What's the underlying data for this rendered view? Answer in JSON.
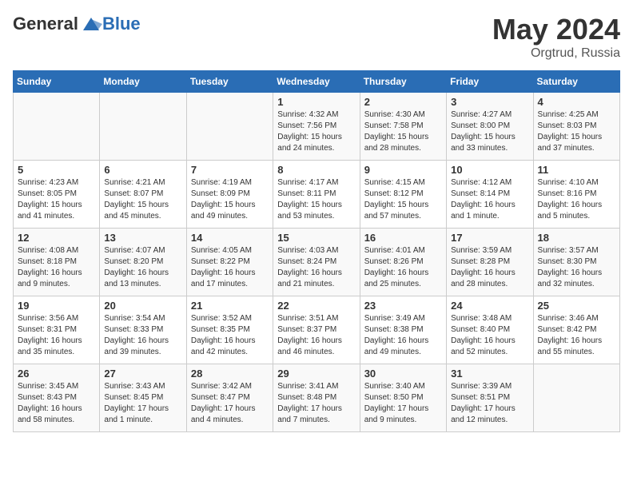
{
  "header": {
    "logo_general": "General",
    "logo_blue": "Blue",
    "title": "May 2024",
    "subtitle": "Orgtrud, Russia"
  },
  "days_of_week": [
    "Sunday",
    "Monday",
    "Tuesday",
    "Wednesday",
    "Thursday",
    "Friday",
    "Saturday"
  ],
  "weeks": [
    [
      {
        "day": "",
        "info": ""
      },
      {
        "day": "",
        "info": ""
      },
      {
        "day": "",
        "info": ""
      },
      {
        "day": "1",
        "info": "Sunrise: 4:32 AM\nSunset: 7:56 PM\nDaylight: 15 hours and 24 minutes."
      },
      {
        "day": "2",
        "info": "Sunrise: 4:30 AM\nSunset: 7:58 PM\nDaylight: 15 hours and 28 minutes."
      },
      {
        "day": "3",
        "info": "Sunrise: 4:27 AM\nSunset: 8:00 PM\nDaylight: 15 hours and 33 minutes."
      },
      {
        "day": "4",
        "info": "Sunrise: 4:25 AM\nSunset: 8:03 PM\nDaylight: 15 hours and 37 minutes."
      }
    ],
    [
      {
        "day": "5",
        "info": "Sunrise: 4:23 AM\nSunset: 8:05 PM\nDaylight: 15 hours and 41 minutes."
      },
      {
        "day": "6",
        "info": "Sunrise: 4:21 AM\nSunset: 8:07 PM\nDaylight: 15 hours and 45 minutes."
      },
      {
        "day": "7",
        "info": "Sunrise: 4:19 AM\nSunset: 8:09 PM\nDaylight: 15 hours and 49 minutes."
      },
      {
        "day": "8",
        "info": "Sunrise: 4:17 AM\nSunset: 8:11 PM\nDaylight: 15 hours and 53 minutes."
      },
      {
        "day": "9",
        "info": "Sunrise: 4:15 AM\nSunset: 8:12 PM\nDaylight: 15 hours and 57 minutes."
      },
      {
        "day": "10",
        "info": "Sunrise: 4:12 AM\nSunset: 8:14 PM\nDaylight: 16 hours and 1 minute."
      },
      {
        "day": "11",
        "info": "Sunrise: 4:10 AM\nSunset: 8:16 PM\nDaylight: 16 hours and 5 minutes."
      }
    ],
    [
      {
        "day": "12",
        "info": "Sunrise: 4:08 AM\nSunset: 8:18 PM\nDaylight: 16 hours and 9 minutes."
      },
      {
        "day": "13",
        "info": "Sunrise: 4:07 AM\nSunset: 8:20 PM\nDaylight: 16 hours and 13 minutes."
      },
      {
        "day": "14",
        "info": "Sunrise: 4:05 AM\nSunset: 8:22 PM\nDaylight: 16 hours and 17 minutes."
      },
      {
        "day": "15",
        "info": "Sunrise: 4:03 AM\nSunset: 8:24 PM\nDaylight: 16 hours and 21 minutes."
      },
      {
        "day": "16",
        "info": "Sunrise: 4:01 AM\nSunset: 8:26 PM\nDaylight: 16 hours and 25 minutes."
      },
      {
        "day": "17",
        "info": "Sunrise: 3:59 AM\nSunset: 8:28 PM\nDaylight: 16 hours and 28 minutes."
      },
      {
        "day": "18",
        "info": "Sunrise: 3:57 AM\nSunset: 8:30 PM\nDaylight: 16 hours and 32 minutes."
      }
    ],
    [
      {
        "day": "19",
        "info": "Sunrise: 3:56 AM\nSunset: 8:31 PM\nDaylight: 16 hours and 35 minutes."
      },
      {
        "day": "20",
        "info": "Sunrise: 3:54 AM\nSunset: 8:33 PM\nDaylight: 16 hours and 39 minutes."
      },
      {
        "day": "21",
        "info": "Sunrise: 3:52 AM\nSunset: 8:35 PM\nDaylight: 16 hours and 42 minutes."
      },
      {
        "day": "22",
        "info": "Sunrise: 3:51 AM\nSunset: 8:37 PM\nDaylight: 16 hours and 46 minutes."
      },
      {
        "day": "23",
        "info": "Sunrise: 3:49 AM\nSunset: 8:38 PM\nDaylight: 16 hours and 49 minutes."
      },
      {
        "day": "24",
        "info": "Sunrise: 3:48 AM\nSunset: 8:40 PM\nDaylight: 16 hours and 52 minutes."
      },
      {
        "day": "25",
        "info": "Sunrise: 3:46 AM\nSunset: 8:42 PM\nDaylight: 16 hours and 55 minutes."
      }
    ],
    [
      {
        "day": "26",
        "info": "Sunrise: 3:45 AM\nSunset: 8:43 PM\nDaylight: 16 hours and 58 minutes."
      },
      {
        "day": "27",
        "info": "Sunrise: 3:43 AM\nSunset: 8:45 PM\nDaylight: 17 hours and 1 minute."
      },
      {
        "day": "28",
        "info": "Sunrise: 3:42 AM\nSunset: 8:47 PM\nDaylight: 17 hours and 4 minutes."
      },
      {
        "day": "29",
        "info": "Sunrise: 3:41 AM\nSunset: 8:48 PM\nDaylight: 17 hours and 7 minutes."
      },
      {
        "day": "30",
        "info": "Sunrise: 3:40 AM\nSunset: 8:50 PM\nDaylight: 17 hours and 9 minutes."
      },
      {
        "day": "31",
        "info": "Sunrise: 3:39 AM\nSunset: 8:51 PM\nDaylight: 17 hours and 12 minutes."
      },
      {
        "day": "",
        "info": ""
      }
    ]
  ]
}
